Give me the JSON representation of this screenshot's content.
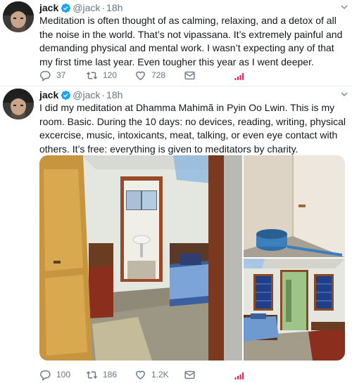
{
  "tweets": [
    {
      "author": {
        "name": "jack",
        "handle": "@jack",
        "verified": true
      },
      "time": "18h",
      "text": "Meditation is often thought of as calming, relaxing, and a detox of all the noise in the world. That’s not vipassana. It’s extremely painful and demanding physical and mental work. I wasn’t expecting any of that my first time last year. Even tougher this year as I went deeper.",
      "actions": {
        "replies": "37",
        "retweets": "120",
        "likes": "728"
      },
      "icons": [
        "reply-icon",
        "retweet-icon",
        "like-icon",
        "direct-message-icon",
        "analytics-icon"
      ]
    },
    {
      "author": {
        "name": "jack",
        "handle": "@jack",
        "verified": true
      },
      "time": "18h",
      "text": "I did my meditation at Dhamma Mahimã in Pyin Oo Lwin. This is my room. Basic. During the 10 days: no devices, reading, writing, physical excercise, music, intoxicants, meat, talking, or even eye contact with others. It’s free: everything is given to meditators by charity.",
      "actions": {
        "replies": "100",
        "retweets": "186",
        "likes": "1.2K"
      },
      "photos": [
        "room-with-door-and-bed-photo",
        "corner-with-blue-bucket-photo",
        "room-with-windows-and-bed-photo"
      ]
    }
  ],
  "colors": {
    "text": "#14171a",
    "secondary": "#657786",
    "verified": "#1da1f2",
    "analytics": "#e0245e",
    "divider": "#e6ecf0"
  }
}
